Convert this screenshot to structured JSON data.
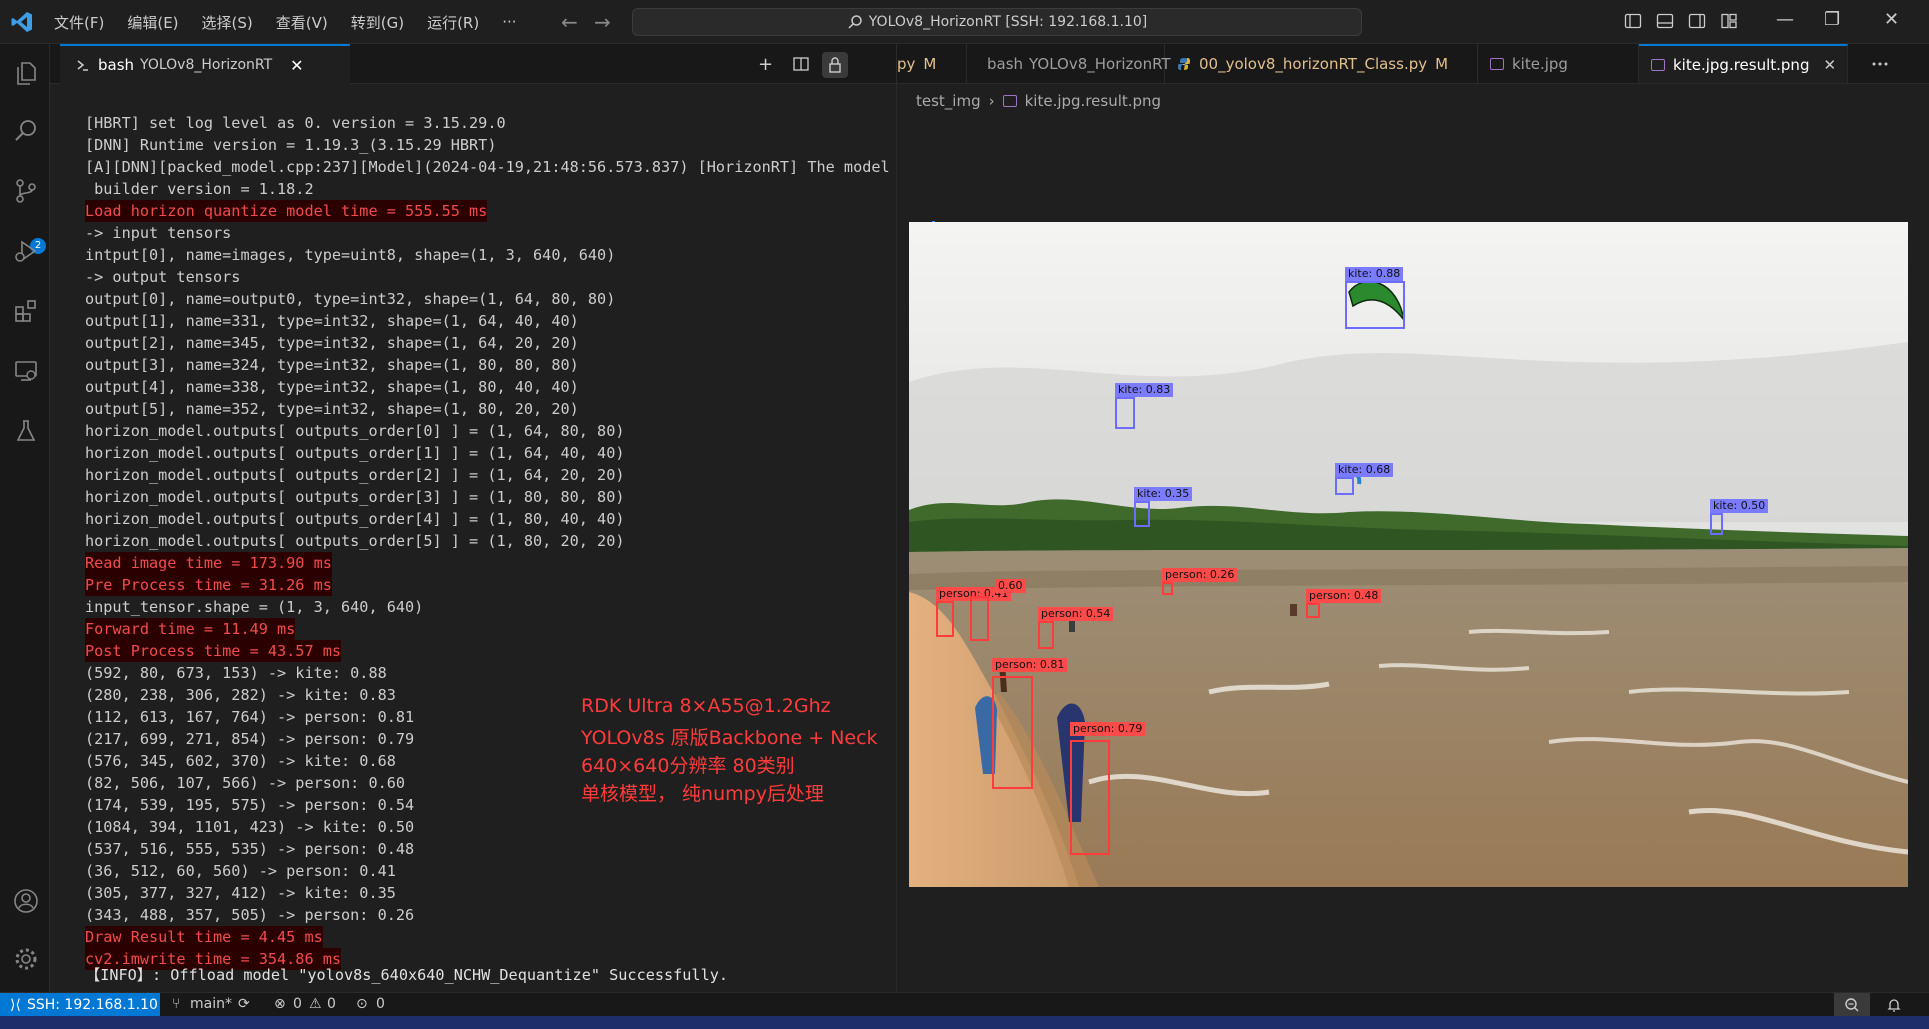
{
  "titlebar": {
    "menu": [
      "文件(F)",
      "编辑(E)",
      "选择(S)",
      "查看(V)",
      "转到(G)",
      "运行(R)",
      "···"
    ],
    "search_text": "YOLOv8_HorizonRT [SSH: 192.168.1.10]"
  },
  "activity": {
    "scm_badge": "2"
  },
  "terminal_tab": {
    "label": "bash",
    "sub": "YOLOv8_HorizonRT",
    "close": "✕"
  },
  "terminal": {
    "lines": [
      {
        "text": "[HBRT] set log level as 0. version = 3.15.29.0",
        "hl": false
      },
      {
        "text": "[DNN] Runtime version = 1.19.3_(3.15.29 HBRT)",
        "hl": false
      },
      {
        "text": "[A][DNN][packed_model.cpp:237][Model](2024-04-19,21:48:56.573.837) [HorizonRT] The model",
        "hl": false
      },
      {
        "text": " builder version = 1.18.2",
        "hl": false
      },
      {
        "text": "Load horizon quantize model time = 555.55 ms",
        "hl": true
      },
      {
        "text": "-> input tensors",
        "hl": false
      },
      {
        "text": "intput[0], name=images, type=uint8, shape=(1, 3, 640, 640)",
        "hl": false
      },
      {
        "text": "-> output tensors",
        "hl": false
      },
      {
        "text": "output[0], name=output0, type=int32, shape=(1, 64, 80, 80)",
        "hl": false
      },
      {
        "text": "output[1], name=331, type=int32, shape=(1, 64, 40, 40)",
        "hl": false
      },
      {
        "text": "output[2], name=345, type=int32, shape=(1, 64, 20, 20)",
        "hl": false
      },
      {
        "text": "output[3], name=324, type=int32, shape=(1, 80, 80, 80)",
        "hl": false
      },
      {
        "text": "output[4], name=338, type=int32, shape=(1, 80, 40, 40)",
        "hl": false
      },
      {
        "text": "output[5], name=352, type=int32, shape=(1, 80, 20, 20)",
        "hl": false
      },
      {
        "text": "horizon_model.outputs[ outputs_order[0] ] = (1, 64, 80, 80)",
        "hl": false
      },
      {
        "text": "horizon_model.outputs[ outputs_order[1] ] = (1, 64, 40, 40)",
        "hl": false
      },
      {
        "text": "horizon_model.outputs[ outputs_order[2] ] = (1, 64, 20, 20)",
        "hl": false
      },
      {
        "text": "horizon_model.outputs[ outputs_order[3] ] = (1, 80, 80, 80)",
        "hl": false
      },
      {
        "text": "horizon_model.outputs[ outputs_order[4] ] = (1, 80, 40, 40)",
        "hl": false
      },
      {
        "text": "horizon_model.outputs[ outputs_order[5] ] = (1, 80, 20, 20)",
        "hl": false
      },
      {
        "text": "Read image time = 173.90 ms",
        "hl": true
      },
      {
        "text": "Pre Process time = 31.26 ms",
        "hl": true
      },
      {
        "text": "input_tensor.shape = (1, 3, 640, 640)",
        "hl": false
      },
      {
        "text": "Forward time = 11.49 ms",
        "hl": true
      },
      {
        "text": "Post Process time = 43.57 ms",
        "hl": true
      },
      {
        "text": "(592, 80, 673, 153) -> kite: 0.88",
        "hl": false
      },
      {
        "text": "(280, 238, 306, 282) -> kite: 0.83",
        "hl": false
      },
      {
        "text": "(112, 613, 167, 764) -> person: 0.81",
        "hl": false
      },
      {
        "text": "(217, 699, 271, 854) -> person: 0.79",
        "hl": false
      },
      {
        "text": "(576, 345, 602, 370) -> kite: 0.68",
        "hl": false
      },
      {
        "text": "(82, 506, 107, 566) -> person: 0.60",
        "hl": false
      },
      {
        "text": "(174, 539, 195, 575) -> person: 0.54",
        "hl": false
      },
      {
        "text": "(1084, 394, 1101, 423) -> kite: 0.50",
        "hl": false
      },
      {
        "text": "(537, 516, 555, 535) -> person: 0.48",
        "hl": false
      },
      {
        "text": "(36, 512, 60, 560) -> person: 0.41",
        "hl": false
      },
      {
        "text": "(305, 377, 327, 412) -> kite: 0.35",
        "hl": false
      },
      {
        "text": "(343, 488, 357, 505) -> person: 0.26",
        "hl": false
      },
      {
        "text": "Draw Result time = 4.45 ms",
        "hl": true
      },
      {
        "text": "cv2.imwrite time = 354.86 ms",
        "hl": true
      },
      {
        "text": "【INFO】: Offload model \"yolov8s_640x640_NCHW_Dequantize\" Successfully.",
        "hl": false
      }
    ],
    "overlay": [
      "RDK Ultra 8×A55@1.2Ghz",
      "YOLOv8s 原版Backbone + Neck",
      "640×640分辨率 80类别",
      "单核模型， 纯numpy后处理"
    ]
  },
  "editor": {
    "tabs": [
      {
        "label": "py",
        "mark": "M"
      },
      {
        "label": "bash",
        "sub": "YOLOv8_HorizonRT"
      },
      {
        "label": "00_yolov8_horizonRT_Class.py",
        "mark": "M"
      },
      {
        "label": "kite.jpg"
      },
      {
        "label": "kite.jpg.result.png",
        "close": "✕"
      }
    ],
    "breadcrumb": [
      "test_img",
      "kite.jpg.result.png"
    ],
    "detections": [
      {
        "cls": "kite",
        "label": "kite: 0.88"
      },
      {
        "cls": "kite",
        "label": "kite: 0.83"
      },
      {
        "cls": "kite",
        "label": "kite: 0.68"
      },
      {
        "cls": "kite",
        "label": "kite: 0.35"
      },
      {
        "cls": "kite",
        "label": "kite: 0.50"
      },
      {
        "cls": "person",
        "label": "person: 0.26"
      },
      {
        "cls": "person",
        "label": "person: 0.48"
      },
      {
        "cls": "person",
        "label": "person: 0.41"
      },
      {
        "cls": "person",
        "label": "0.60"
      },
      {
        "cls": "person",
        "label": "person: 0.54"
      },
      {
        "cls": "person",
        "label": "person: 0.81"
      },
      {
        "cls": "person",
        "label": "person: 0.79"
      }
    ]
  },
  "statusbar": {
    "remote": "SSH: 192.168.1.10",
    "branch": "main*",
    "errors": "0",
    "warnings": "0",
    "ports": "0"
  },
  "colors": {
    "accent": "#0078d4",
    "kite_box": "#6c6cff",
    "person_box": "#ff3c3c",
    "log_highlight": "#f14c4c"
  }
}
